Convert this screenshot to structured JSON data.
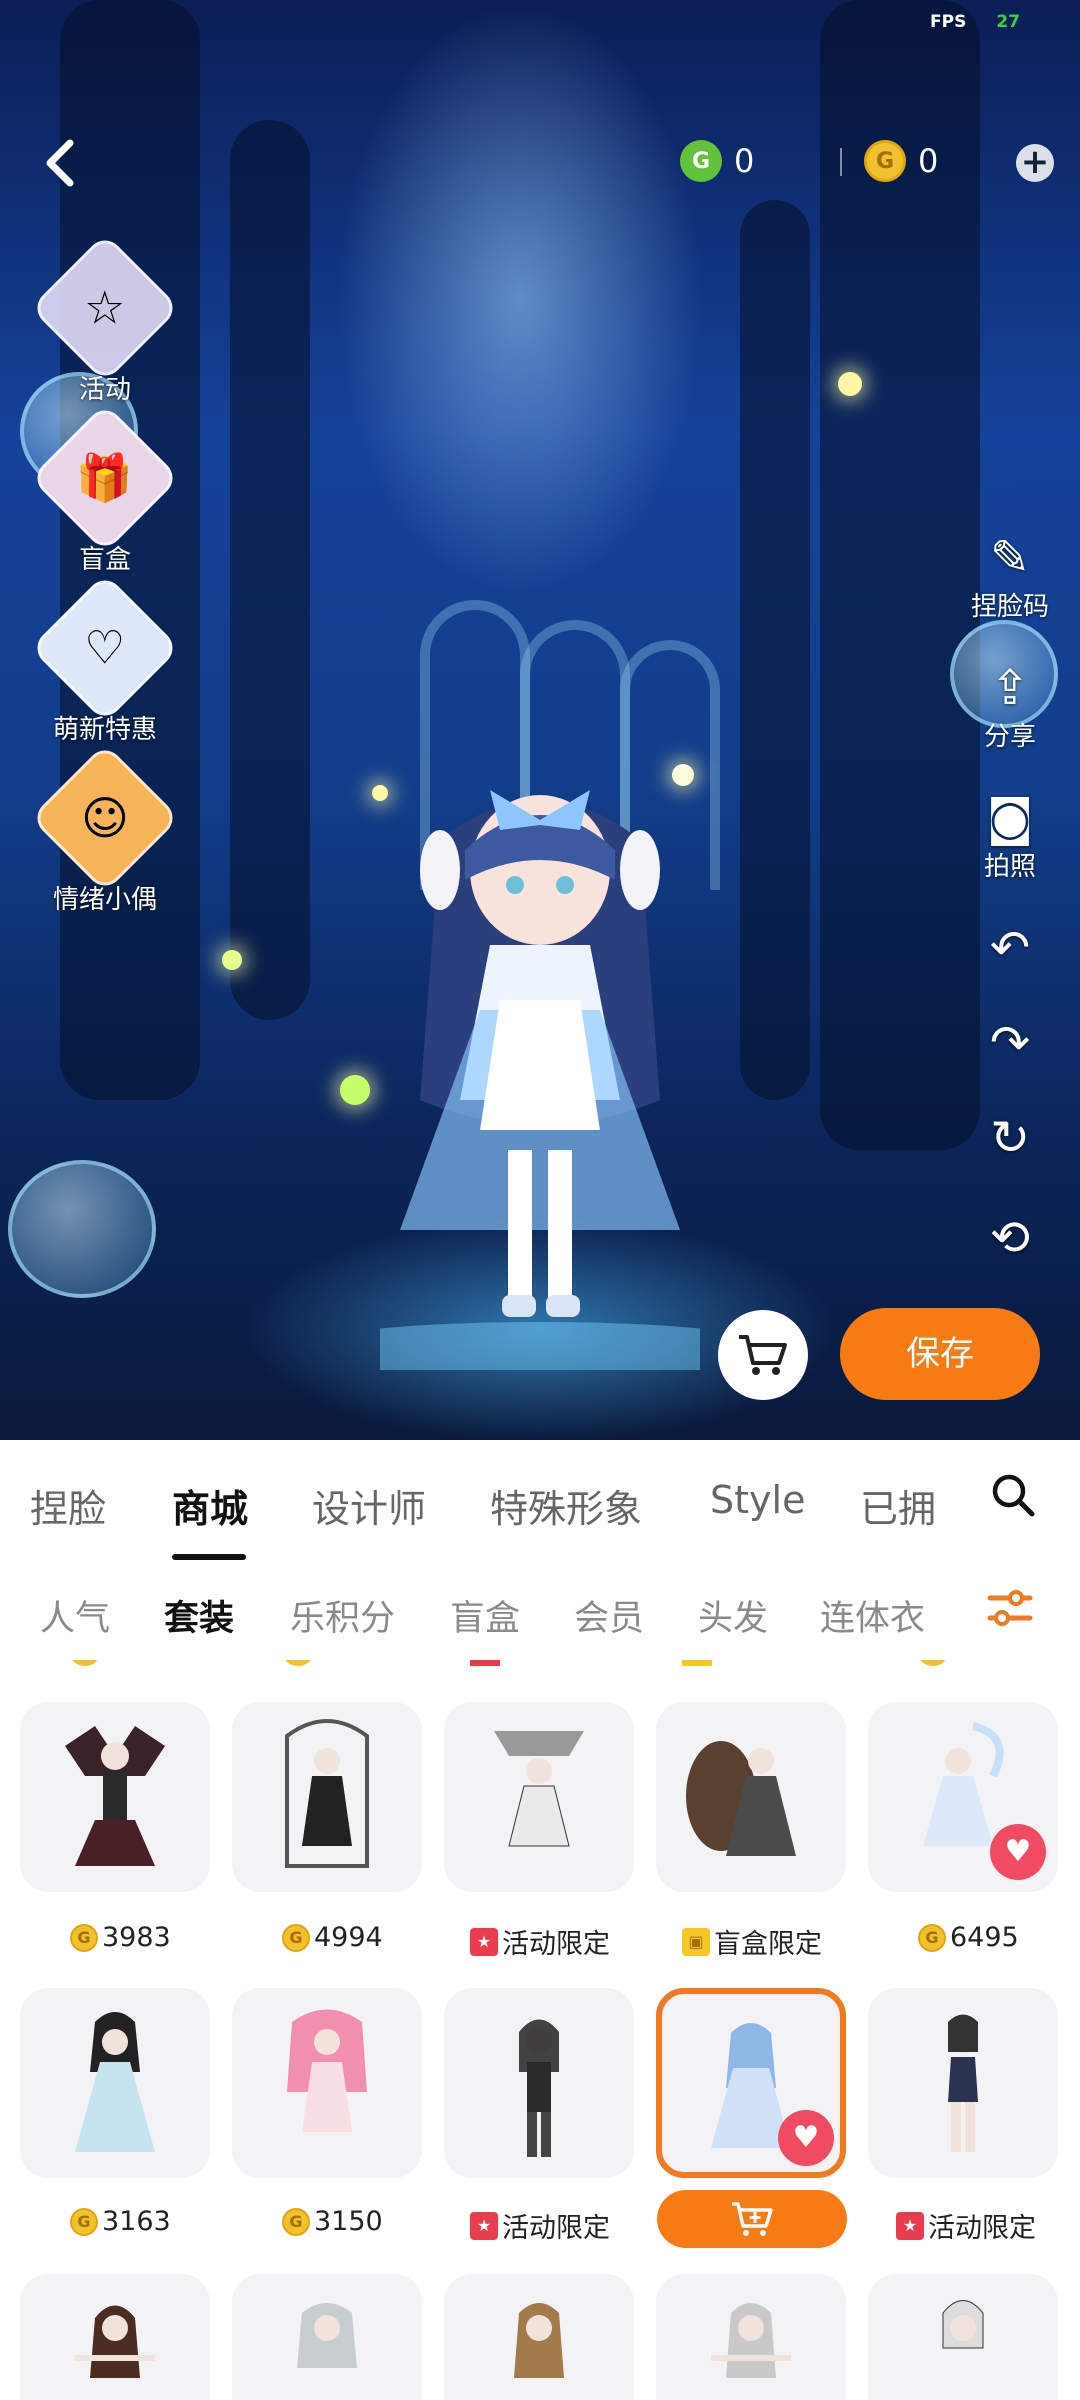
{
  "status": {
    "fps_label": "FPS",
    "fps_value": "27"
  },
  "header": {
    "back_icon": "chevron-left-icon",
    "green_currency": "0",
    "gold_currency": "0"
  },
  "left_menu": [
    {
      "label": "活动",
      "icon": "star-badge-icon"
    },
    {
      "label": "盲盒",
      "icon": "gift-box-icon"
    },
    {
      "label": "萌新特惠",
      "icon": "newbie-deal-icon"
    },
    {
      "label": "情绪小偶",
      "icon": "emotion-doll-icon"
    }
  ],
  "right_tools": [
    {
      "label": "捏脸码",
      "icon": "face-code-icon"
    },
    {
      "label": "分享",
      "icon": "share-icon"
    },
    {
      "label": "拍照",
      "icon": "camera-icon"
    },
    {
      "label": "",
      "icon": "undo-icon"
    },
    {
      "label": "",
      "icon": "redo-icon"
    },
    {
      "label": "",
      "icon": "rotate-icon"
    },
    {
      "label": "",
      "icon": "reset-icon"
    }
  ],
  "actions": {
    "save_label": "保存"
  },
  "main_tabs": [
    "捏脸",
    "商城",
    "设计师",
    "特殊形象",
    "Style",
    "已拥"
  ],
  "active_main_tab": "商城",
  "sub_tabs": [
    "人气",
    "套装",
    "乐积分",
    "盲盒",
    "会员",
    "头发",
    "连体衣"
  ],
  "active_sub_tab": "套装",
  "items_row1": [
    {
      "price_type": "coin",
      "price": "3983"
    },
    {
      "price_type": "coin",
      "price": "4994"
    },
    {
      "price_type": "event",
      "price": "活动限定"
    },
    {
      "price_type": "blindbox",
      "price": "盲盒限定"
    },
    {
      "price_type": "coin",
      "price": "6495",
      "favorited": true
    }
  ],
  "items_row2": [
    {
      "price_type": "coin",
      "price": "3163"
    },
    {
      "price_type": "coin",
      "price": "3150"
    },
    {
      "price_type": "event",
      "price": "活动限定"
    },
    {
      "price_type": "buy",
      "price": "",
      "favorited": true,
      "selected": true
    },
    {
      "price_type": "event",
      "price": "活动限定"
    }
  ],
  "colors": {
    "accent": "#f67b14",
    "heart": "#f04b63",
    "coin": "#f1c22b",
    "green_coin": "#62c23a"
  }
}
